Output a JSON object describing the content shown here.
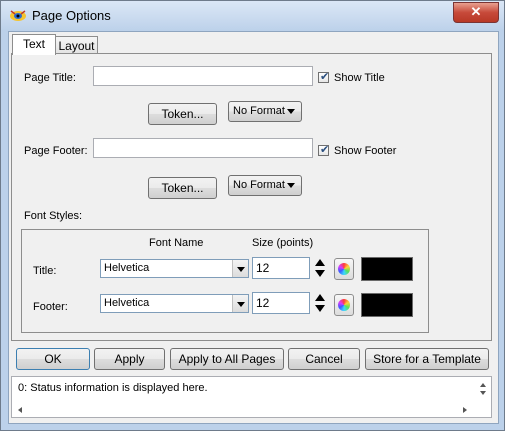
{
  "window": {
    "title": "Page Options",
    "close_label": "✕"
  },
  "tabs": [
    {
      "label": "Text",
      "active": true
    },
    {
      "label": "Layout",
      "active": false
    }
  ],
  "page_title": {
    "label": "Page Title:",
    "value": "",
    "show_label": "Show Title",
    "show_checked": true,
    "token_label": "Token...",
    "format_value": "No Format"
  },
  "page_footer": {
    "label": "Page Footer:",
    "value": "",
    "show_label": "Show Footer",
    "show_checked": true,
    "token_label": "Token...",
    "format_value": "No Format"
  },
  "font_styles": {
    "label": "Font Styles:",
    "col_font_name": "Font Name",
    "col_size": "Size (points)",
    "rows": [
      {
        "label": "Title:",
        "font": "Helvetica",
        "size": "12",
        "color": "#000000"
      },
      {
        "label": "Footer:",
        "font": "Helvetica",
        "size": "12",
        "color": "#000000"
      }
    ]
  },
  "buttons": {
    "ok": "OK",
    "apply": "Apply",
    "apply_all": "Apply to All Pages",
    "cancel": "Cancel",
    "store_template": "Store for a Template"
  },
  "status": {
    "text": "0: Status information is displayed here."
  },
  "colors": {
    "close_button": "#c74a3a",
    "titlebar": "#bcd1ea",
    "swatch": "#000000"
  }
}
